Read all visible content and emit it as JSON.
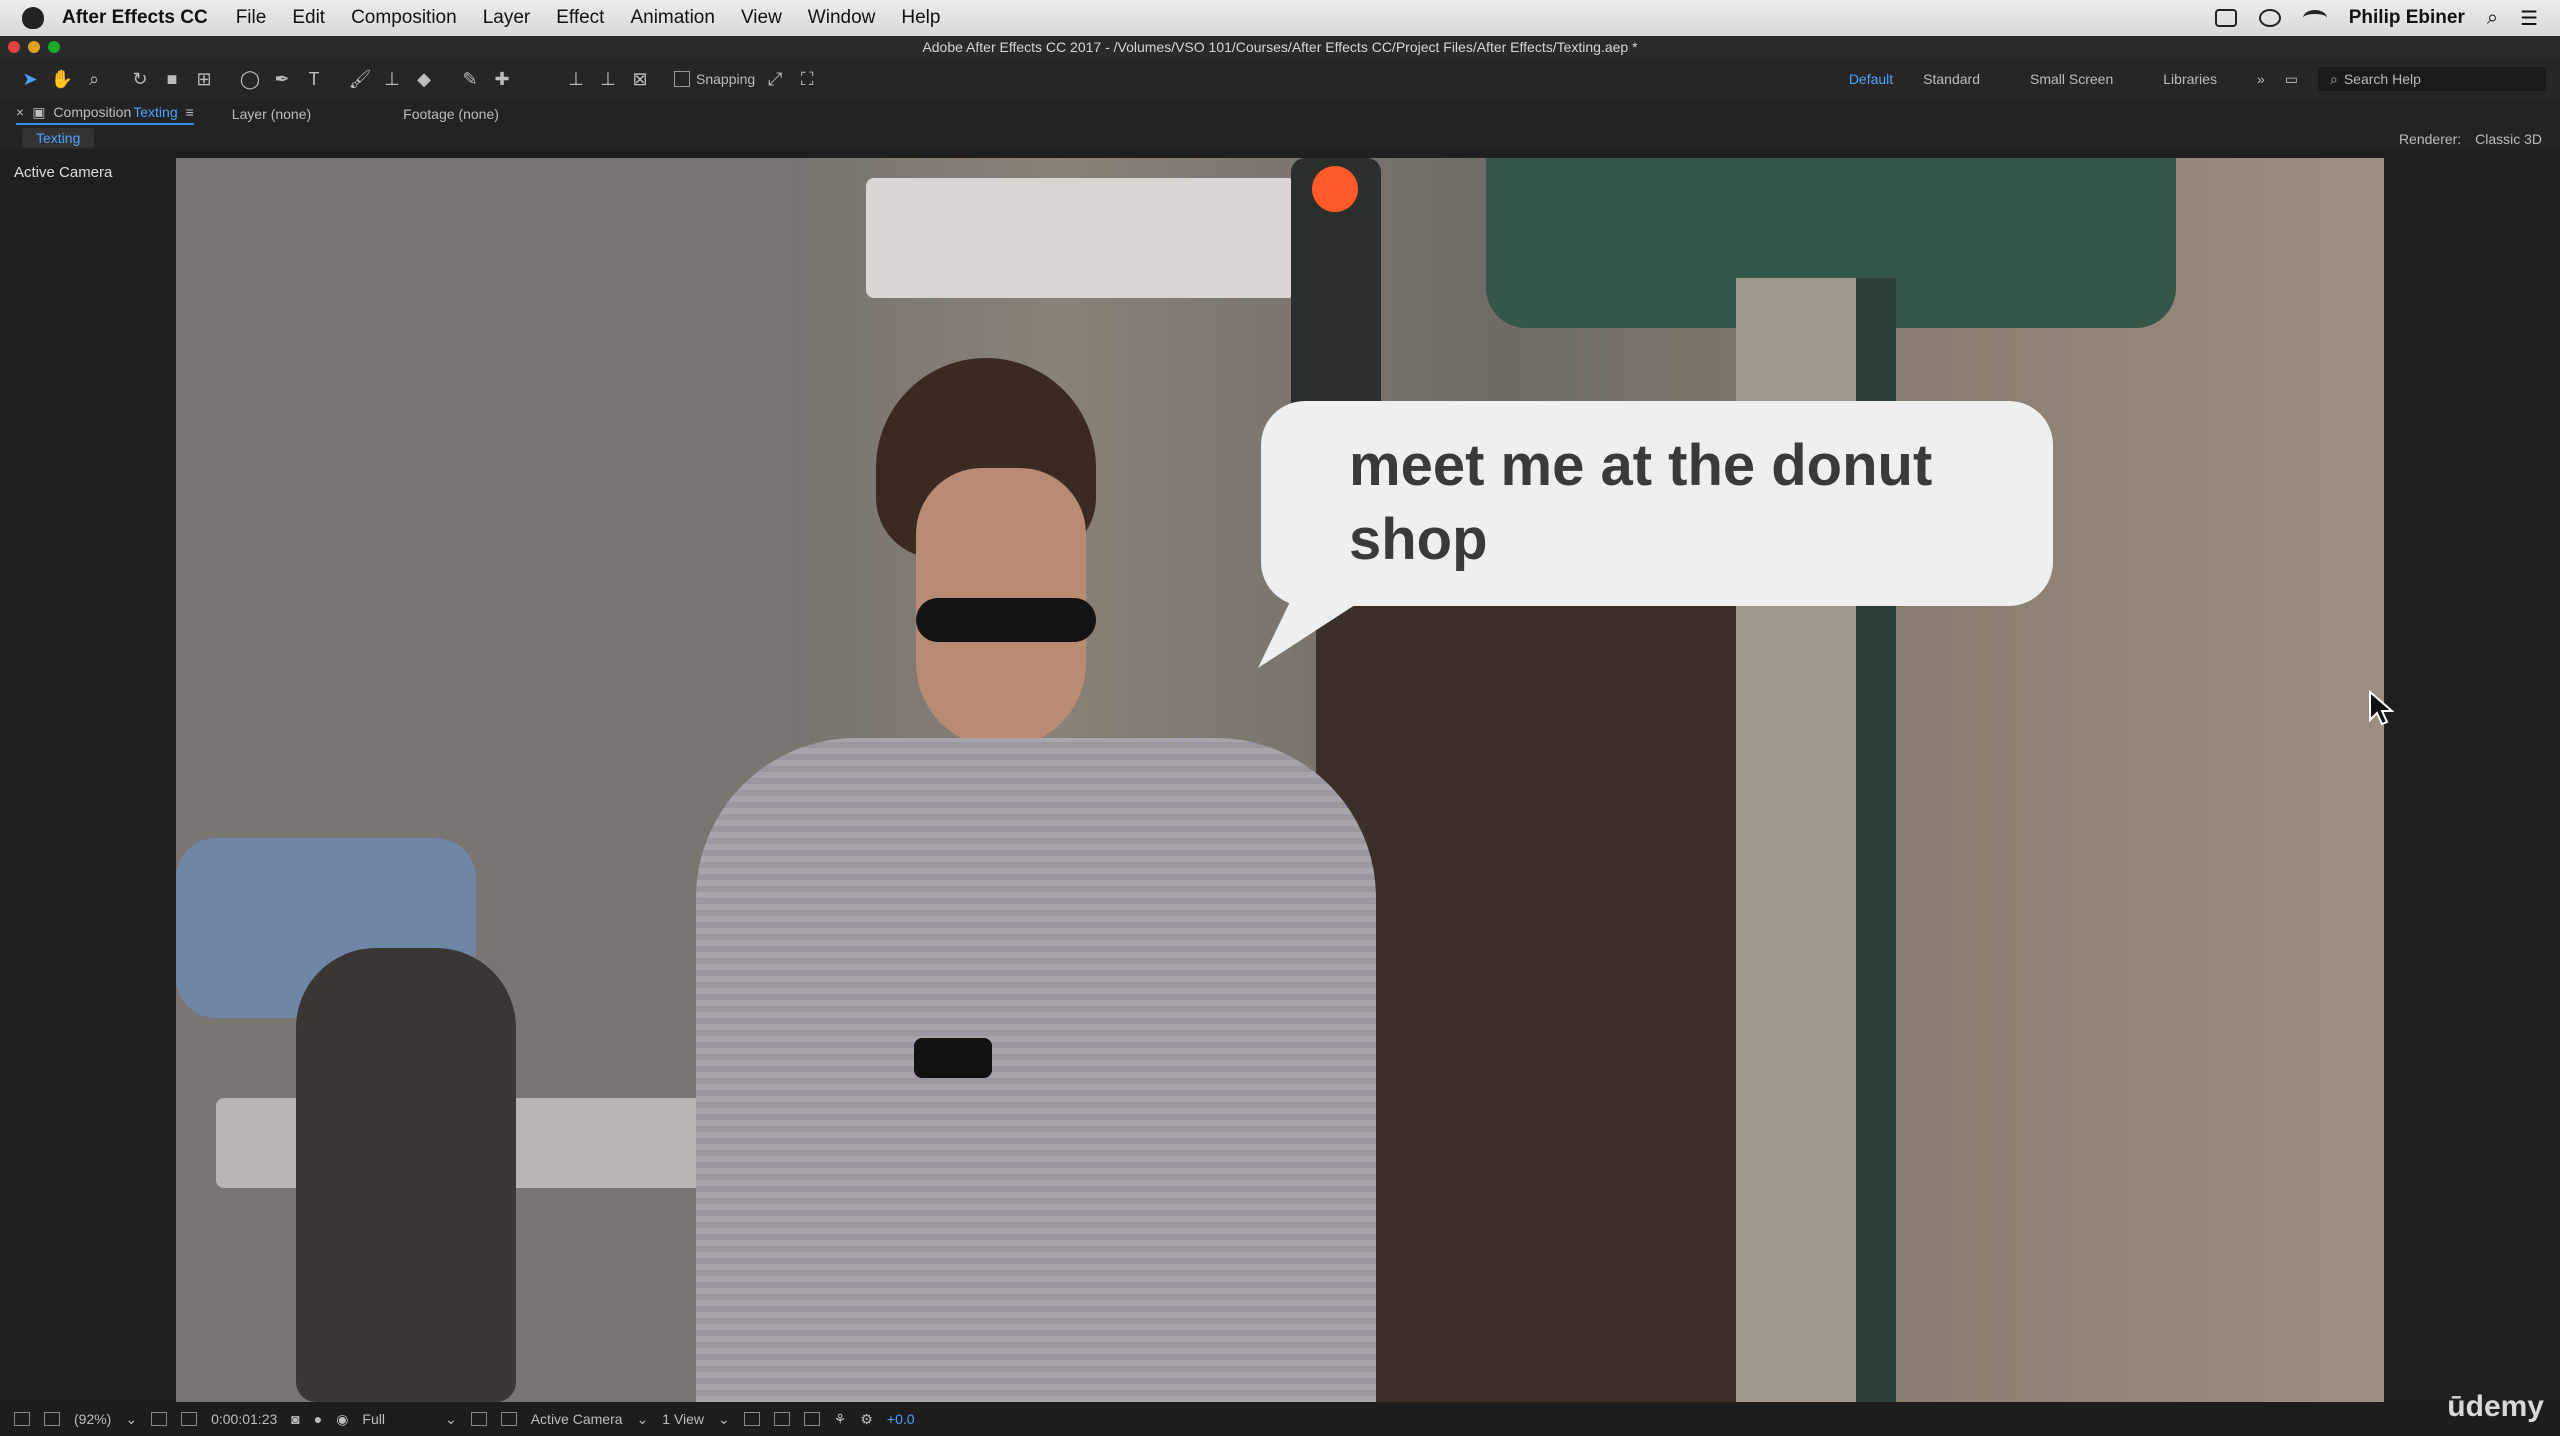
{
  "menubar": {
    "app_name": "After Effects CC",
    "menus": [
      "File",
      "Edit",
      "Composition",
      "Layer",
      "Effect",
      "Animation",
      "View",
      "Window",
      "Help"
    ],
    "user": "Philip Ebiner"
  },
  "window": {
    "title": "Adobe After Effects CC 2017 - /Volumes/VSO 101/Courses/After Effects CC/Project Files/After Effects/Texting.aep *"
  },
  "toolbar": {
    "snapping_label": "Snapping",
    "workspaces": [
      "Default",
      "Standard",
      "Small Screen",
      "Libraries"
    ],
    "search_placeholder": "Search Help"
  },
  "panel": {
    "composition_prefix": "Composition",
    "composition_name": "Texting",
    "layer_tab": "Layer (none)",
    "footage_tab": "Footage (none)",
    "comp_tab_label": "Texting",
    "renderer_label": "Renderer:",
    "renderer_value": "Classic 3D",
    "camera_label": "Active Camera"
  },
  "canvas": {
    "bubble_text": "meet me at the donut shop"
  },
  "statusbar": {
    "zoom": "(92%)",
    "timecode": "0:00:01:23",
    "resolution": "Full",
    "camera": "Active Camera",
    "views": "1 View",
    "exposure": "+0.0"
  },
  "branding": {
    "watermark": "ūdemy"
  }
}
